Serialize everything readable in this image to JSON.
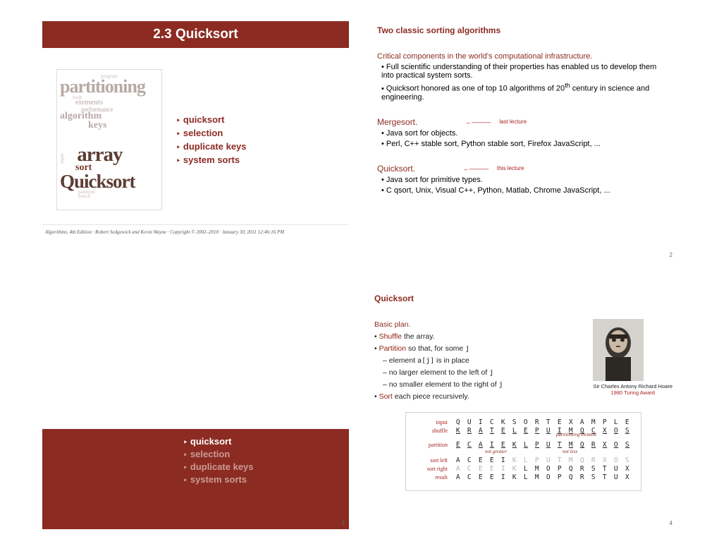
{
  "slide1": {
    "title": "2.3  Quicksort",
    "wordcloud": {
      "w1": "partitioning",
      "w2": "elements",
      "w2b": "performance",
      "w3": "algorithm",
      "w3b": "keys",
      "w5": "array",
      "w6": "sort",
      "w7": "Quicksort",
      "small1": "input",
      "small2": "program",
      "small3": "hash",
      "small4": "partition",
      "small5": "bunch"
    },
    "toc": [
      "quicksort",
      "selection",
      "duplicate keys",
      "system sorts"
    ],
    "footer": "Algorithms, 4th Edition     ·     Robert Sedgewick and Kevin Wayne     ·     Copyright © 2002–2010     ·     January 30, 2011 12:46:16 PM"
  },
  "slide2": {
    "title": "Two classic sorting algorithms",
    "heading": "Critical components in the world's computational infrastructure.",
    "b1": "Full scientific understanding of their properties has enabled us to develop them into practical system sorts.",
    "b2_a": "Quicksort honored as one of top 10 algorithms of 20",
    "b2_b": " century in science and engineering.",
    "b2_sup": "th",
    "mergesort": "Mergesort.",
    "mergesort_note": "last lecture",
    "m1": "Java sort for objects.",
    "m2": "Perl, C++ stable sort, Python stable sort, Firefox JavaScript, ...",
    "quicksort": "Quicksort.",
    "quicksort_note": "this lecture",
    "q1": "Java sort for primitive types.",
    "q2": "C qsort, Unix, Visual C++, Python, Matlab, Chrome JavaScript, ...",
    "page": "2"
  },
  "slide3": {
    "toc": [
      "quicksort",
      "selection",
      "duplicate keys",
      "system sorts"
    ],
    "page": "3"
  },
  "slide4": {
    "title": "Quicksort",
    "plan_head": "Basic plan.",
    "b1a": "Shuffle",
    "b1b": " the array.",
    "b2a": "Partition",
    "b2b": " so that, for some ",
    "b2c": "j",
    "b3": "element ",
    "b3c": "a[j]",
    "b3b": " is in place",
    "b4": "no larger element to the left of ",
    "b4c": "j",
    "b5": "no smaller element to the right of ",
    "b5c": "j",
    "b6a": "Sort",
    "b6b": " each piece recursively.",
    "caption1": "Sir Charles Antony Richard Hoare",
    "caption2": "1980 Turing Award",
    "trace": {
      "labels": [
        "input",
        "shuffle",
        "partition",
        "sort left",
        "sort right",
        "result"
      ],
      "input": [
        "Q",
        "U",
        "I",
        "C",
        "K",
        "S",
        "O",
        "R",
        "T",
        "E",
        "X",
        "A",
        "M",
        "P",
        "L",
        "E"
      ],
      "shuffle": [
        "K",
        "R",
        "A",
        "T",
        "E",
        "L",
        "E",
        "P",
        "U",
        "I",
        "M",
        "Q",
        "C",
        "X",
        "O",
        "S"
      ],
      "partition": [
        "E",
        "C",
        "A",
        "I",
        "E",
        "K",
        "L",
        "P",
        "U",
        "T",
        "M",
        "Q",
        "R",
        "X",
        "O",
        "S"
      ],
      "sortleft": [
        "A",
        "C",
        "E",
        "E",
        "I",
        "K",
        "L",
        "P",
        "U",
        "T",
        "M",
        "Q",
        "R",
        "X",
        "O",
        "S"
      ],
      "sortright": [
        "A",
        "C",
        "E",
        "E",
        "I",
        "K",
        "L",
        "M",
        "O",
        "P",
        "Q",
        "R",
        "S",
        "T",
        "U",
        "X"
      ],
      "result": [
        "A",
        "C",
        "E",
        "E",
        "I",
        "K",
        "L",
        "M",
        "O",
        "P",
        "Q",
        "R",
        "S",
        "T",
        "U",
        "X"
      ],
      "anno1": "partitioning element",
      "anno2": "not greater",
      "anno3": "not less"
    },
    "page": "4"
  }
}
